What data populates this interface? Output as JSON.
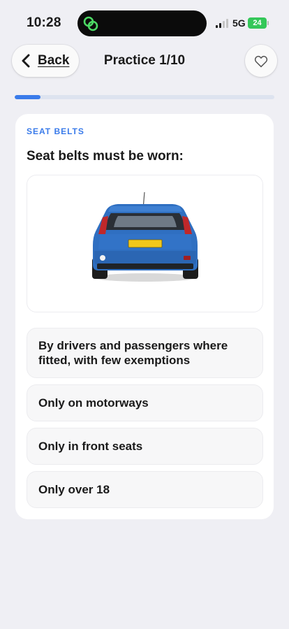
{
  "status_bar": {
    "time": "10:28",
    "network": "5G",
    "battery": "24"
  },
  "header": {
    "back_label": "Back",
    "title": "Practice 1/10",
    "favorite_icon": "heart-outline-icon"
  },
  "progress": {
    "fraction": 0.1,
    "color": "#3a7bea"
  },
  "question": {
    "category": "SEAT BELTS",
    "text": "Seat belts must be worn:",
    "options": [
      "By drivers and passengers where fitted, with few exemptions",
      "Only on motorways",
      "Only in front seats",
      "Only over 18"
    ]
  },
  "colors": {
    "accent": "#3a7bea",
    "background": "#efeff4",
    "card": "#ffffff"
  }
}
